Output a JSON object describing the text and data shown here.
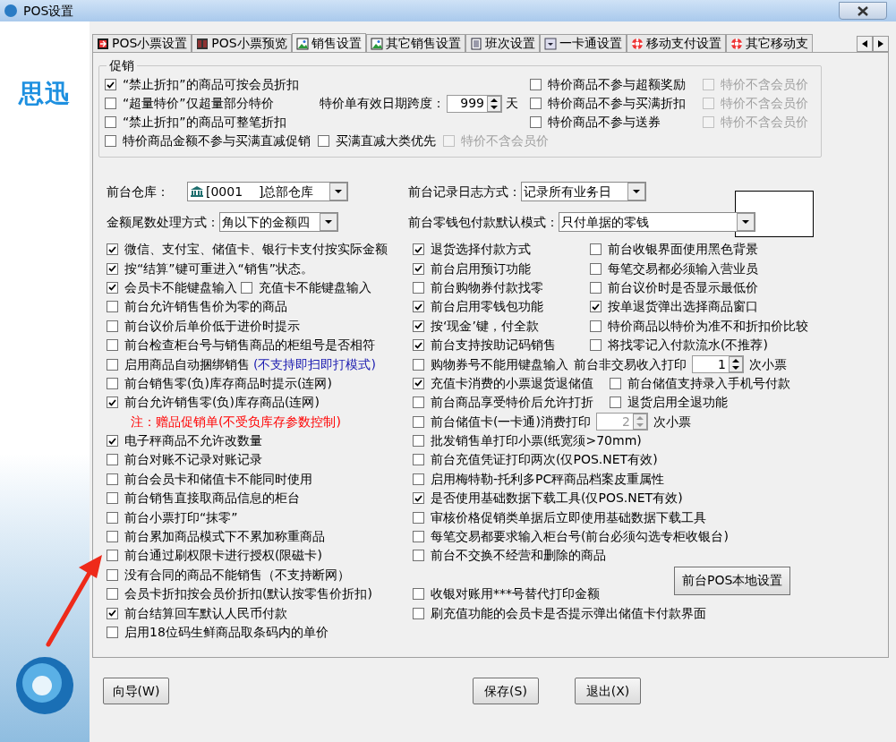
{
  "window": {
    "title": "POS设置"
  },
  "logo": {
    "text": "思迅"
  },
  "tabs": [
    {
      "label": "POS小票设置",
      "selected": false
    },
    {
      "label": "POS小票预览",
      "selected": false
    },
    {
      "label": "销售设置",
      "selected": true
    },
    {
      "label": "其它销售设置",
      "selected": false
    },
    {
      "label": "班次设置",
      "selected": false
    },
    {
      "label": "一卡通设置",
      "selected": false
    },
    {
      "label": "移动支付设置",
      "selected": false
    },
    {
      "label": "其它移动支",
      "selected": false
    }
  ],
  "promo": {
    "title": "促销",
    "left": [
      {
        "label": "“禁止折扣”的商品可按会员折扣",
        "checked": true,
        "disabled": false
      },
      {
        "label": "“超量特价”仅超量部分特价",
        "checked": false,
        "disabled": false
      },
      {
        "label": "“禁止折扣”的商品可整笔折扣",
        "checked": false,
        "disabled": false
      }
    ],
    "span": {
      "label": "特价单有效日期跨度：",
      "value": "999",
      "unit": "天"
    },
    "middle": [
      {
        "label": "特价商品不参与超额奖励",
        "checked": false,
        "disabled": false
      },
      {
        "label": "特价商品不参与买满折扣",
        "checked": false,
        "disabled": false
      },
      {
        "label": "特价商品不参与送券",
        "checked": false,
        "disabled": false
      }
    ],
    "right": [
      {
        "label": "特价不含会员价",
        "checked": false,
        "disabled": true
      },
      {
        "label": "特价不含会员价",
        "checked": false,
        "disabled": true
      },
      {
        "label": "特价不含会员价",
        "checked": false,
        "disabled": true
      }
    ],
    "bottom": [
      {
        "label": "特价商品金额不参与买满直减促销",
        "checked": false,
        "disabled": false
      },
      {
        "label": "买满直减大类优先",
        "checked": false,
        "disabled": false
      },
      {
        "label": "特价不含会员价",
        "checked": false,
        "disabled": true
      }
    ]
  },
  "fields": [
    [
      {
        "label": "前台仓库：",
        "value": "[0001    ]总部仓库"
      },
      {
        "label": "前台记录日志方式：",
        "value": "记录所有业务日"
      }
    ],
    [
      {
        "label": "金额尾数处理方式：",
        "value": "角以下的金额四"
      },
      {
        "label": "前台零钱包付款默认模式：",
        "value": "只付单据的零钱"
      }
    ]
  ],
  "rows": [
    {
      "left": [
        {
          "kind": "checkbox",
          "label": "微信、支付宝、储值卡、银行卡支付按实际金额",
          "checked": true
        }
      ],
      "right": [
        {
          "kind": "checkbox",
          "label": "退货选择付款方式",
          "checked": true
        },
        {
          "kind": "checkbox",
          "label": "前台收银界面使用黑色背景",
          "checked": false
        }
      ]
    },
    {
      "left": [
        {
          "kind": "checkbox",
          "label": "按“结算”键可重进入“销售”状态。",
          "checked": true
        }
      ],
      "right": [
        {
          "kind": "checkbox",
          "label": "前台启用预订功能",
          "checked": true
        },
        {
          "kind": "checkbox",
          "label": "每笔交易都必须输入营业员",
          "checked": false
        }
      ]
    },
    {
      "left": [
        {
          "kind": "checkbox",
          "label": "会员卡不能键盘输入",
          "checked": true
        },
        {
          "kind": "checkbox",
          "label": "充值卡不能键盘输入",
          "checked": false
        }
      ],
      "right": [
        {
          "kind": "checkbox",
          "label": "前台购物券付款找零",
          "checked": false
        },
        {
          "kind": "checkbox",
          "label": "前台议价时是否显示最低价",
          "checked": false
        }
      ]
    },
    {
      "left": [
        {
          "kind": "checkbox",
          "label": "前台允许销售售价为零的商品",
          "checked": false
        }
      ],
      "right": [
        {
          "kind": "checkbox",
          "label": "前台启用零钱包功能",
          "checked": true
        },
        {
          "kind": "checkbox",
          "label": "按单退货弹出选择商品窗口",
          "checked": true
        }
      ]
    },
    {
      "left": [
        {
          "kind": "checkbox",
          "label": "前台议价后单价低于进价时提示",
          "checked": false
        }
      ],
      "right": [
        {
          "kind": "checkbox",
          "label": "按‘现金’键，付全款",
          "checked": true
        },
        {
          "kind": "checkbox",
          "label": "特价商品以特价为准不和折扣价比较",
          "checked": false
        }
      ]
    },
    {
      "left": [
        {
          "kind": "checkbox",
          "label": "前台检查柜台号与销售商品的柜组号是否相符",
          "checked": false
        }
      ],
      "right": [
        {
          "kind": "checkbox",
          "label": "前台支持按助记码销售",
          "checked": true
        },
        {
          "kind": "checkbox",
          "label": "将找零记入付款流水(不推荐)",
          "checked": false
        }
      ]
    },
    {
      "left": [
        {
          "kind": "checkbox",
          "label": "启用商品自动捆绑销售",
          "checked": false
        },
        {
          "kind": "note",
          "text": "(不支持即扫即打模式)",
          "color": "#1a1ab0"
        }
      ],
      "right": [
        {
          "kind": "checkbox",
          "label": "购物券号不能用键盘输入",
          "checked": false
        },
        {
          "kind": "label",
          "text": "前台非交易收入打印"
        },
        {
          "kind": "spinner",
          "value": "1",
          "disabled": false
        },
        {
          "kind": "label",
          "text": "次小票"
        }
      ]
    },
    {
      "left": [
        {
          "kind": "checkbox",
          "label": "前台销售零(负)库存商品时提示(连网)",
          "checked": false
        }
      ],
      "right": [
        {
          "kind": "checkbox",
          "label": "充值卡消费的小票退货退储值",
          "checked": true
        },
        {
          "kind": "checkbox",
          "label": "前台储值支持录入手机号付款",
          "checked": false
        }
      ]
    },
    {
      "left": [
        {
          "kind": "checkbox",
          "label": "前台允许销售零(负)库存商品(连网)",
          "checked": true
        }
      ],
      "right": [
        {
          "kind": "checkbox",
          "label": "前台商品享受特价后允许打折",
          "checked": false
        },
        {
          "kind": "checkbox",
          "label": "退货启用全退功能",
          "checked": false
        }
      ]
    },
    {
      "left": [
        {
          "kind": "note",
          "text": "注：赠品促销单(不受负库存参数控制)",
          "color": "#ff0000"
        }
      ],
      "right": [
        {
          "kind": "checkbox",
          "label": "前台储值卡(一卡通)消费打印",
          "checked": false
        },
        {
          "kind": "spinner",
          "value": "2",
          "disabled": true
        },
        {
          "kind": "label",
          "text": "次小票"
        }
      ]
    },
    {
      "left": [
        {
          "kind": "checkbox",
          "label": "电子秤商品不允许改数量",
          "checked": true
        }
      ],
      "right": [
        {
          "kind": "checkbox",
          "label": "批发销售单打印小票(纸宽须>70mm)",
          "checked": false
        }
      ]
    },
    {
      "left": [
        {
          "kind": "checkbox",
          "label": "前台对账不记录对账记录",
          "checked": false
        }
      ],
      "right": [
        {
          "kind": "checkbox",
          "label": "前台充值凭证打印两次(仅POS.NET有效)",
          "checked": false
        }
      ]
    },
    {
      "left": [
        {
          "kind": "checkbox",
          "label": "前台会员卡和储值卡不能同时使用",
          "checked": false
        }
      ],
      "right": [
        {
          "kind": "checkbox",
          "label": "启用梅特勒-托利多PC秤商品档案皮重属性",
          "checked": false
        }
      ]
    },
    {
      "left": [
        {
          "kind": "checkbox",
          "label": "前台销售直接取商品信息的柜台",
          "checked": false
        }
      ],
      "right": [
        {
          "kind": "checkbox",
          "label": "是否使用基础数据下载工具(仅POS.NET有效)",
          "checked": true
        }
      ]
    },
    {
      "left": [
        {
          "kind": "checkbox",
          "label": "前台小票打印“抹零”",
          "checked": false
        }
      ],
      "right": [
        {
          "kind": "checkbox",
          "label": "审核价格促销类单据后立即使用基础数据下载工具",
          "checked": false
        }
      ]
    },
    {
      "left": [
        {
          "kind": "checkbox",
          "label": "前台累加商品模式下不累加称重商品",
          "checked": false
        }
      ],
      "right": [
        {
          "kind": "checkbox",
          "label": "每笔交易都要求输入柜台号(前台必须勾选专柜收银台)",
          "checked": false
        }
      ]
    },
    {
      "left": [
        {
          "kind": "checkbox",
          "label": "前台通过刷权限卡进行授权(限磁卡)",
          "checked": false
        }
      ],
      "right": [
        {
          "kind": "checkbox",
          "label": "前台不交换不经营和删除的商品",
          "checked": false
        }
      ]
    },
    {
      "left": [
        {
          "kind": "checkbox",
          "label": "没有合同的商品不能销售（不支持断网）",
          "checked": false
        }
      ],
      "right": [
        {
          "kind": "button",
          "label": "前台POS本地设置"
        }
      ]
    },
    {
      "left": [
        {
          "kind": "checkbox",
          "label": "会员卡折扣按会员价折扣(默认按零售价折扣)",
          "checked": false
        }
      ],
      "right": [
        {
          "kind": "checkbox",
          "label": "收银对账用***号替代打印金额",
          "checked": false
        }
      ]
    },
    {
      "left": [
        {
          "kind": "checkbox",
          "label": "前台结算回车默认人民币付款",
          "checked": true
        }
      ],
      "right": [
        {
          "kind": "checkbox",
          "label": "刷充值功能的会员卡是否提示弹出储值卡付款界面",
          "checked": false
        }
      ]
    },
    {
      "left": [
        {
          "kind": "checkbox",
          "label": "启用18位码生鲜商品取条码内的单价",
          "checked": false
        }
      ],
      "right": []
    }
  ],
  "buttons": [
    "向导(W)",
    "保存(S)",
    "退出(X)"
  ]
}
